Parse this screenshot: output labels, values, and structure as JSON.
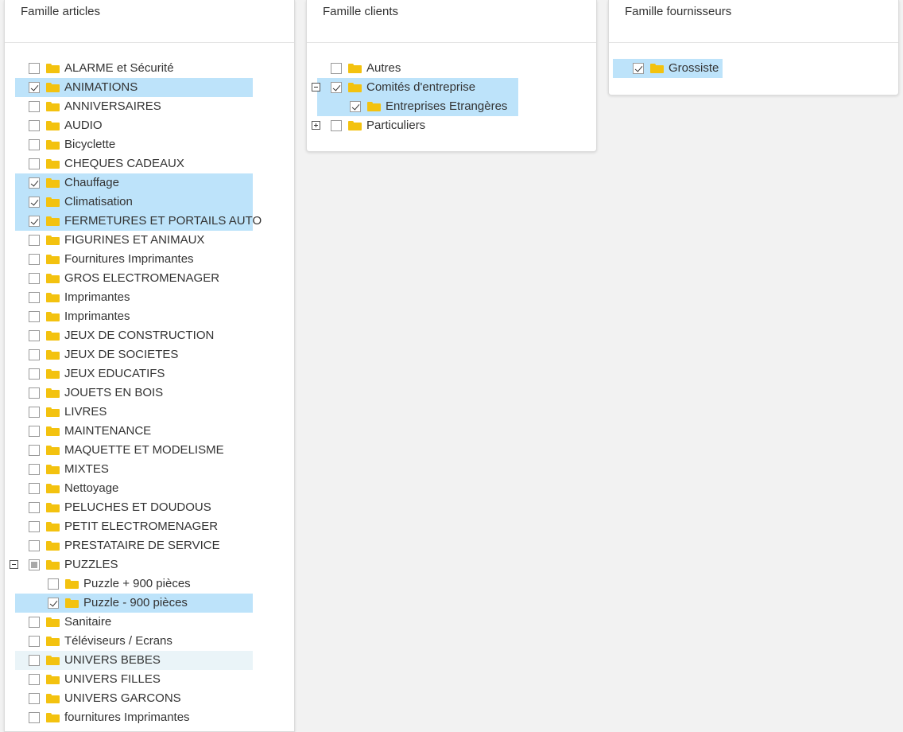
{
  "articles": {
    "title": "Famille articles",
    "items": [
      {
        "label": "ALARME et Sécurité",
        "checked": false,
        "selected": false,
        "level": 0
      },
      {
        "label": "ANIMATIONS",
        "checked": true,
        "selected": true,
        "level": 0
      },
      {
        "label": "ANNIVERSAIRES",
        "checked": false,
        "selected": false,
        "level": 0
      },
      {
        "label": "AUDIO",
        "checked": false,
        "selected": false,
        "level": 0
      },
      {
        "label": "Bicyclette",
        "checked": false,
        "selected": false,
        "level": 0
      },
      {
        "label": "CHEQUES CADEAUX",
        "checked": false,
        "selected": false,
        "level": 0
      },
      {
        "label": "Chauffage",
        "checked": true,
        "selected": true,
        "level": 0
      },
      {
        "label": "Climatisation",
        "checked": true,
        "selected": true,
        "level": 0
      },
      {
        "label": "FERMETURES ET PORTAILS AUTO",
        "checked": true,
        "selected": true,
        "level": 0
      },
      {
        "label": "FIGURINES ET ANIMAUX",
        "checked": false,
        "selected": false,
        "level": 0
      },
      {
        "label": "Fournitures Imprimantes",
        "checked": false,
        "selected": false,
        "level": 0
      },
      {
        "label": "GROS ELECTROMENAGER",
        "checked": false,
        "selected": false,
        "level": 0
      },
      {
        "label": "Imprimantes",
        "checked": false,
        "selected": false,
        "level": 0
      },
      {
        "label": "Imprimantes",
        "checked": false,
        "selected": false,
        "level": 0
      },
      {
        "label": "JEUX DE CONSTRUCTION",
        "checked": false,
        "selected": false,
        "level": 0
      },
      {
        "label": "JEUX DE SOCIETES",
        "checked": false,
        "selected": false,
        "level": 0
      },
      {
        "label": "JEUX EDUCATIFS",
        "checked": false,
        "selected": false,
        "level": 0
      },
      {
        "label": "JOUETS EN BOIS",
        "checked": false,
        "selected": false,
        "level": 0
      },
      {
        "label": "LIVRES",
        "checked": false,
        "selected": false,
        "level": 0
      },
      {
        "label": "MAINTENANCE",
        "checked": false,
        "selected": false,
        "level": 0
      },
      {
        "label": "MAQUETTE ET MODELISME",
        "checked": false,
        "selected": false,
        "level": 0
      },
      {
        "label": "MIXTES",
        "checked": false,
        "selected": false,
        "level": 0
      },
      {
        "label": "Nettoyage",
        "checked": false,
        "selected": false,
        "level": 0
      },
      {
        "label": "PELUCHES ET DOUDOUS",
        "checked": false,
        "selected": false,
        "level": 0
      },
      {
        "label": "PETIT ELECTROMENAGER",
        "checked": false,
        "selected": false,
        "level": 0
      },
      {
        "label": "PRESTATAIRE DE SERVICE",
        "checked": false,
        "selected": false,
        "level": 0
      },
      {
        "label": "PUZZLES",
        "checked": "partial",
        "selected": false,
        "level": 0,
        "expander": "minus"
      },
      {
        "label": "Puzzle + 900 pièces",
        "checked": false,
        "selected": false,
        "level": 1
      },
      {
        "label": "Puzzle - 900 pièces",
        "checked": true,
        "selected": true,
        "level": 1
      },
      {
        "label": "Sanitaire",
        "checked": false,
        "selected": false,
        "level": 0
      },
      {
        "label": "Téléviseurs / Ecrans",
        "checked": false,
        "selected": false,
        "level": 0
      },
      {
        "label": "UNIVERS BEBES",
        "checked": false,
        "selected": false,
        "hover": true,
        "level": 0
      },
      {
        "label": "UNIVERS FILLES",
        "checked": false,
        "selected": false,
        "level": 0
      },
      {
        "label": "UNIVERS GARCONS",
        "checked": false,
        "selected": false,
        "level": 0
      },
      {
        "label": "fournitures Imprimantes",
        "checked": false,
        "selected": false,
        "level": 0
      }
    ]
  },
  "clients": {
    "title": "Famille clients",
    "items": [
      {
        "label": "Autres",
        "checked": false,
        "selected": false,
        "level": 0
      },
      {
        "label": "Comités d'entreprise",
        "checked": true,
        "selected": true,
        "level": 0,
        "expander": "minus"
      },
      {
        "label": "Entreprises Etrangères",
        "checked": true,
        "selected": true,
        "level": 1
      },
      {
        "label": "Particuliers",
        "checked": false,
        "selected": false,
        "level": 0,
        "expander": "plus"
      }
    ]
  },
  "fournisseurs": {
    "title": "Famille fournisseurs",
    "items": [
      {
        "label": "Grossiste",
        "checked": true,
        "selected": true,
        "level": 0
      }
    ]
  },
  "colors": {
    "selected_bg": "#bde3fa",
    "hover_bg": "#eaf4f8",
    "folder": "#f3c20f"
  },
  "icons": {
    "folder": "folder-icon",
    "checkbox": "checkbox-icon",
    "expander": "expander-icon"
  }
}
